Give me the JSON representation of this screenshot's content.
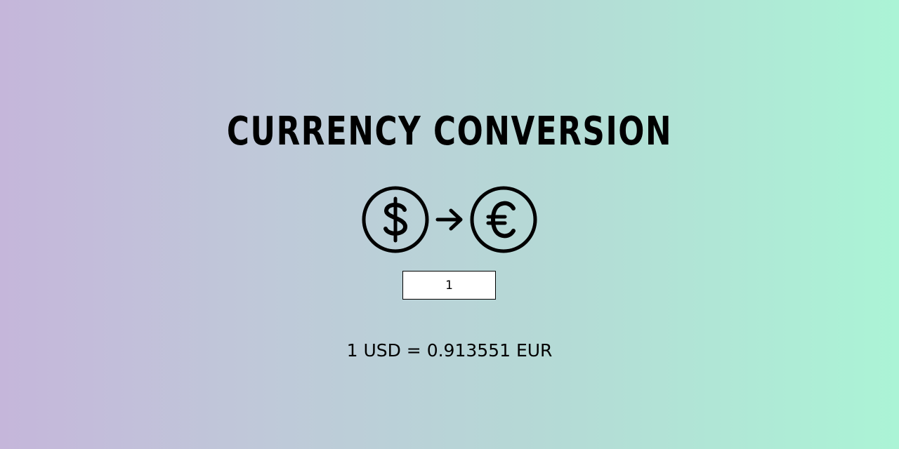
{
  "header": {
    "title": "CURRENCY CONVERSION"
  },
  "icons": {
    "from": "dollar-coin-icon",
    "arrow": "arrow-right-icon",
    "to": "euro-coin-icon"
  },
  "converter": {
    "amount_value": "1",
    "result_text": "1 USD = 0.913551 EUR"
  },
  "colors": {
    "gradient_start": "#c5b6da",
    "gradient_end": "#abf4d6"
  }
}
